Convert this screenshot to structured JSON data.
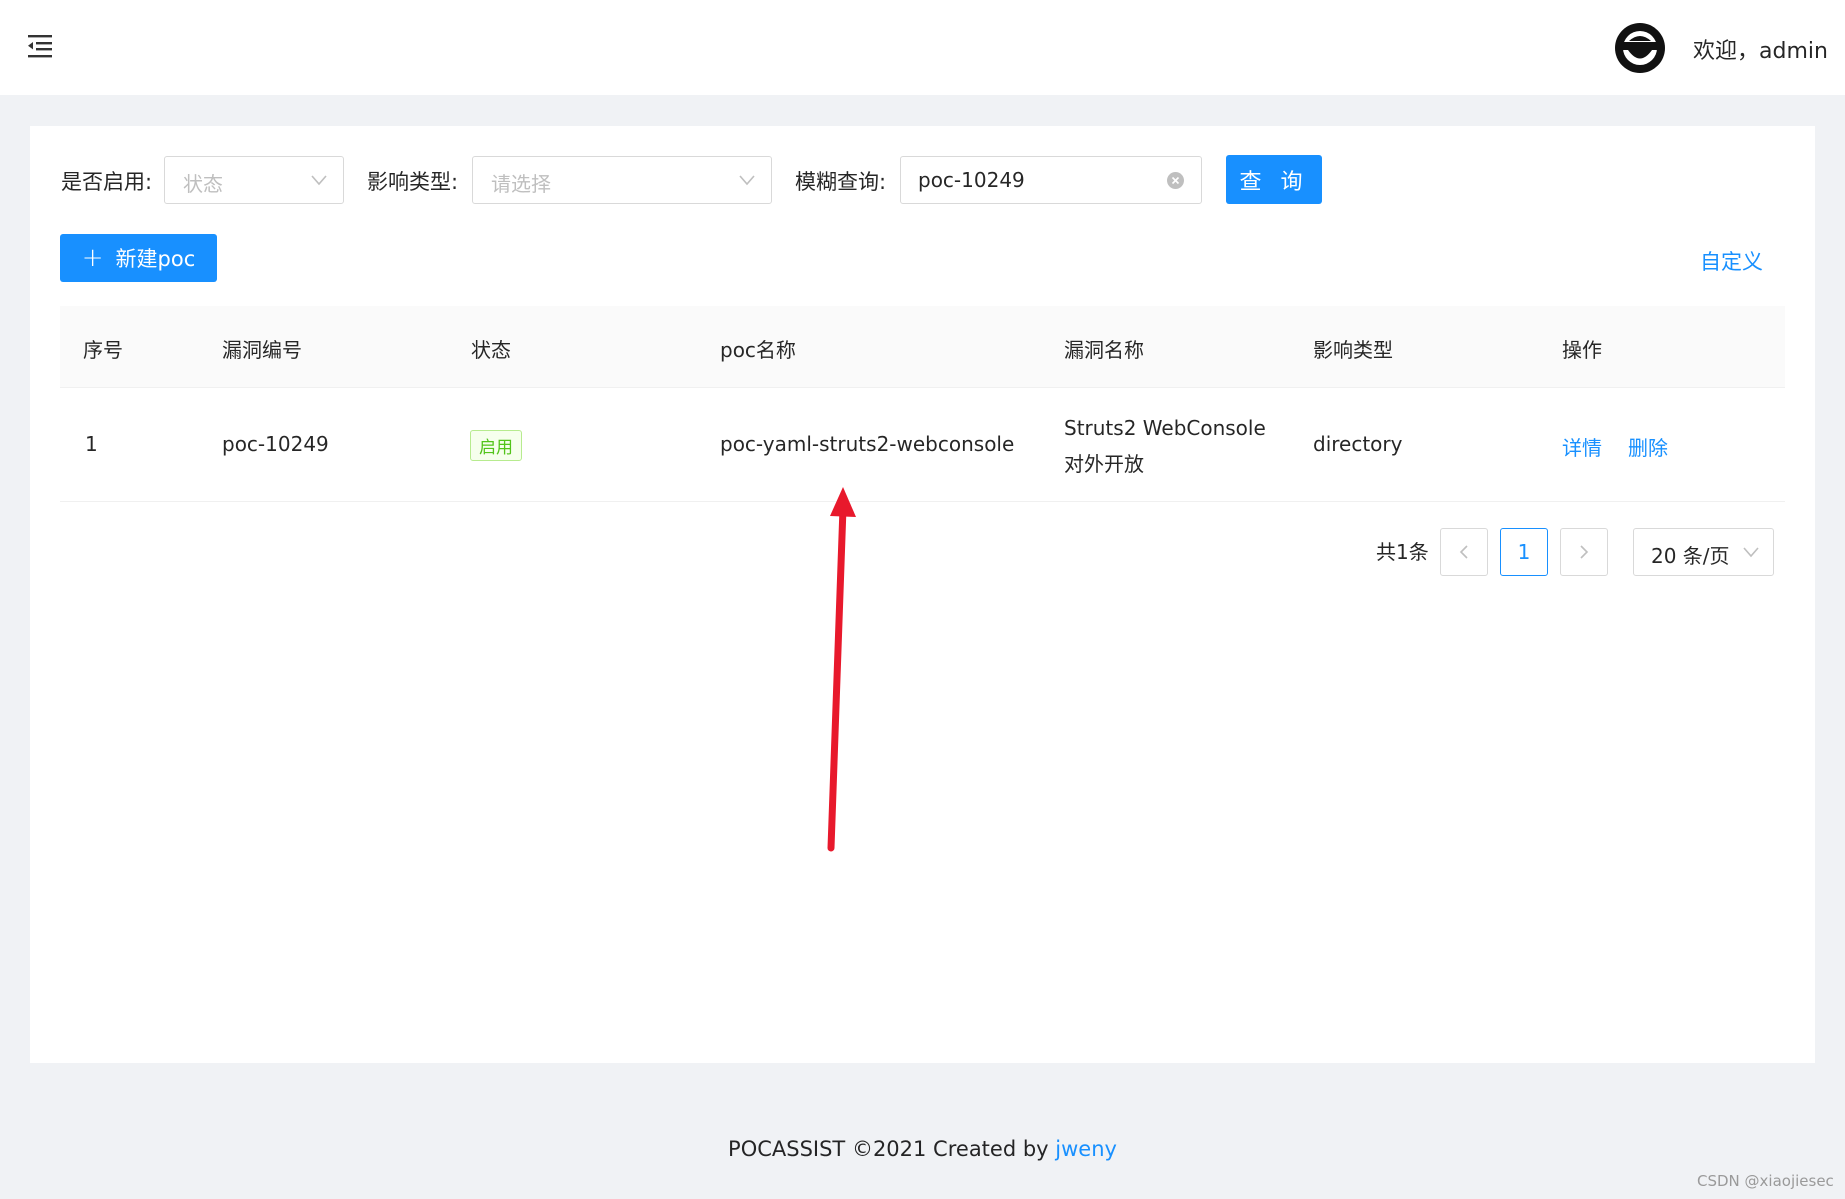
{
  "header": {
    "menu_icon": "menu-fold-icon",
    "avatar_icon": "ninja-avatar-icon",
    "welcome": "欢迎，admin"
  },
  "filters": {
    "enabled_label": "是否启用:",
    "enabled_placeholder": "状态",
    "impact_label": "影响类型:",
    "impact_placeholder": "请选择",
    "fuzzy_label": "模糊查询:",
    "fuzzy_value": "poc-10249",
    "query_button": "查 询"
  },
  "toolbar": {
    "new_button": "新建poc",
    "custom_link": "自定义"
  },
  "table": {
    "columns": [
      "序号",
      "漏洞编号",
      "状态",
      "poc名称",
      "漏洞名称",
      "影响类型",
      "操作"
    ],
    "rows": [
      {
        "index": "1",
        "vuln_id": "poc-10249",
        "status": "启用",
        "poc_name": "poc-yaml-struts2-webconsole",
        "vuln_name_line1": "Struts2 WebConsole",
        "vuln_name_line2": "对外开放",
        "impact_type": "directory",
        "action_detail": "详情",
        "action_delete": "删除"
      }
    ]
  },
  "pagination": {
    "total": "共1条",
    "prev_icon": "chevron-left-icon",
    "current_page": "1",
    "next_icon": "chevron-right-icon",
    "page_size": "20 条/页"
  },
  "footer": {
    "text": "POCASSIST ©2021 Created by ",
    "author_link": "jweny"
  },
  "watermark": "CSDN @xiaojiesec",
  "colors": {
    "primary": "#1890ff",
    "success": "#52c41a",
    "annotation_arrow": "#e8192c"
  }
}
